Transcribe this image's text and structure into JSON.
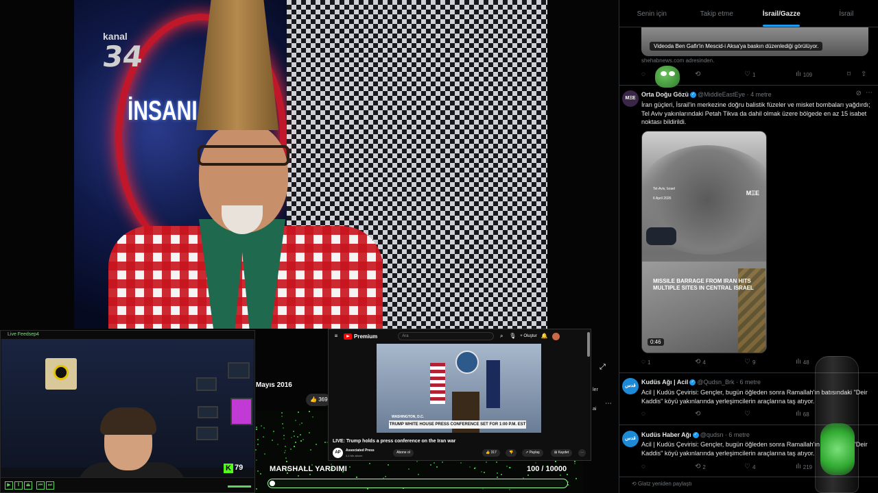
{
  "tv": {
    "channel_label": "kanal",
    "channel_number": "34",
    "show_title": "İNSANI"
  },
  "webcam": {
    "title": "Live Feedsep4",
    "kick_count": "79"
  },
  "stream_overlay": {
    "date_text": "Mayıs 2016",
    "like_count": "369",
    "goal_title": "MARSHALL YARDIMI",
    "goal_count": "100 / 10000",
    "goal_current": 100,
    "goal_target": 10000
  },
  "youtube": {
    "brand": "Premium",
    "search_placeholder": "Ara",
    "create_label": "Oluştur",
    "chyron_location": "WASHINGTON, D.C.",
    "chyron": "TRUMP WHITE HOUSE PRESS CONFERENCE SET FOR 1:00 P.M. EST",
    "video_title": "LIVE: Trump holds a press conference on the Iran war",
    "channel_name": "Associated Press",
    "channel_subs": "4,4 Mn abone",
    "subscribe_label": "Abone ol",
    "like_count": "317",
    "share_label": "Paylaş",
    "save_label": "Kaydet",
    "side_snip1": "ler",
    "side_snip2": "ai"
  },
  "twitter": {
    "tabs": [
      "Senin için",
      "Takip etme",
      "İsrail/Gazze",
      "İsrail"
    ],
    "prev_tweet": {
      "caption": "Videoda Ben Gafir'in Mescid-i Aksa'ya baskın düzenlediği görülüyor.",
      "source": "shehabnews.com adresinden.",
      "likes": "1",
      "views": "109"
    },
    "tweet1": {
      "name": "Orta Doğu Gözü",
      "handle": "@MiddleEastEye · 4 metre",
      "avatar_text": "MΞE",
      "body": "İran güçleri, İsrail'in merkezine doğru balistik füzeler ve misket bombaları yağdırdı; Tel Aviv yakınlarındaki Petah Tikva da dahil olmak üzere bölgede en az 15 isabet noktası bildirildi.",
      "video_location": "Tel-Aviv, Israel",
      "video_date": "6 April 2026",
      "video_watermark": "MΞE",
      "video_overlay": "MISSILE BARRAGE FROM IRAN HITS MULTIPLE SITES IN CENTRAL ISRAEL",
      "duration": "0:46",
      "replies": "1",
      "reposts": "4",
      "likes": "9",
      "views": "48"
    },
    "tweet2": {
      "name": "Kudüs Ağı | Acil",
      "handle": "@Qudsn_Brk · 6 metre",
      "avatar_text": "قدس",
      "body": "Acil | Kudüs Çevirisi: Gençler, bugün öğleden sonra Ramallah'ın batısındaki \"Deir Kaddis\" köyü yakınlarında yerleşimcilerin araçlarına taş atıyor.",
      "views": "68"
    },
    "tweet3": {
      "name": "Kudüs Haber Ağı",
      "handle": "@qudsn · 6 metre",
      "avatar_text": "قدس",
      "body": "Acil | Kudüs Çevirisi: Gençler, bugün öğleden sonra Ramallah'ın batısındaki \"Deir Kaddis\" köyü yakınlarında yerleşimcilerin araçlarına taş atıyor.",
      "reposts": "2",
      "likes": "4",
      "views": "219"
    },
    "repost_note": "Glatz yeniden paylaştı"
  },
  "icons": {
    "reply": "💬",
    "repost": "⟲",
    "like": "♡",
    "views": "📊",
    "bookmark": "🔖",
    "share": "⇧"
  },
  "colors": {
    "accent": "#1d9bf0",
    "youtube_red": "#ff0000",
    "kick_green": "#53fc18"
  }
}
